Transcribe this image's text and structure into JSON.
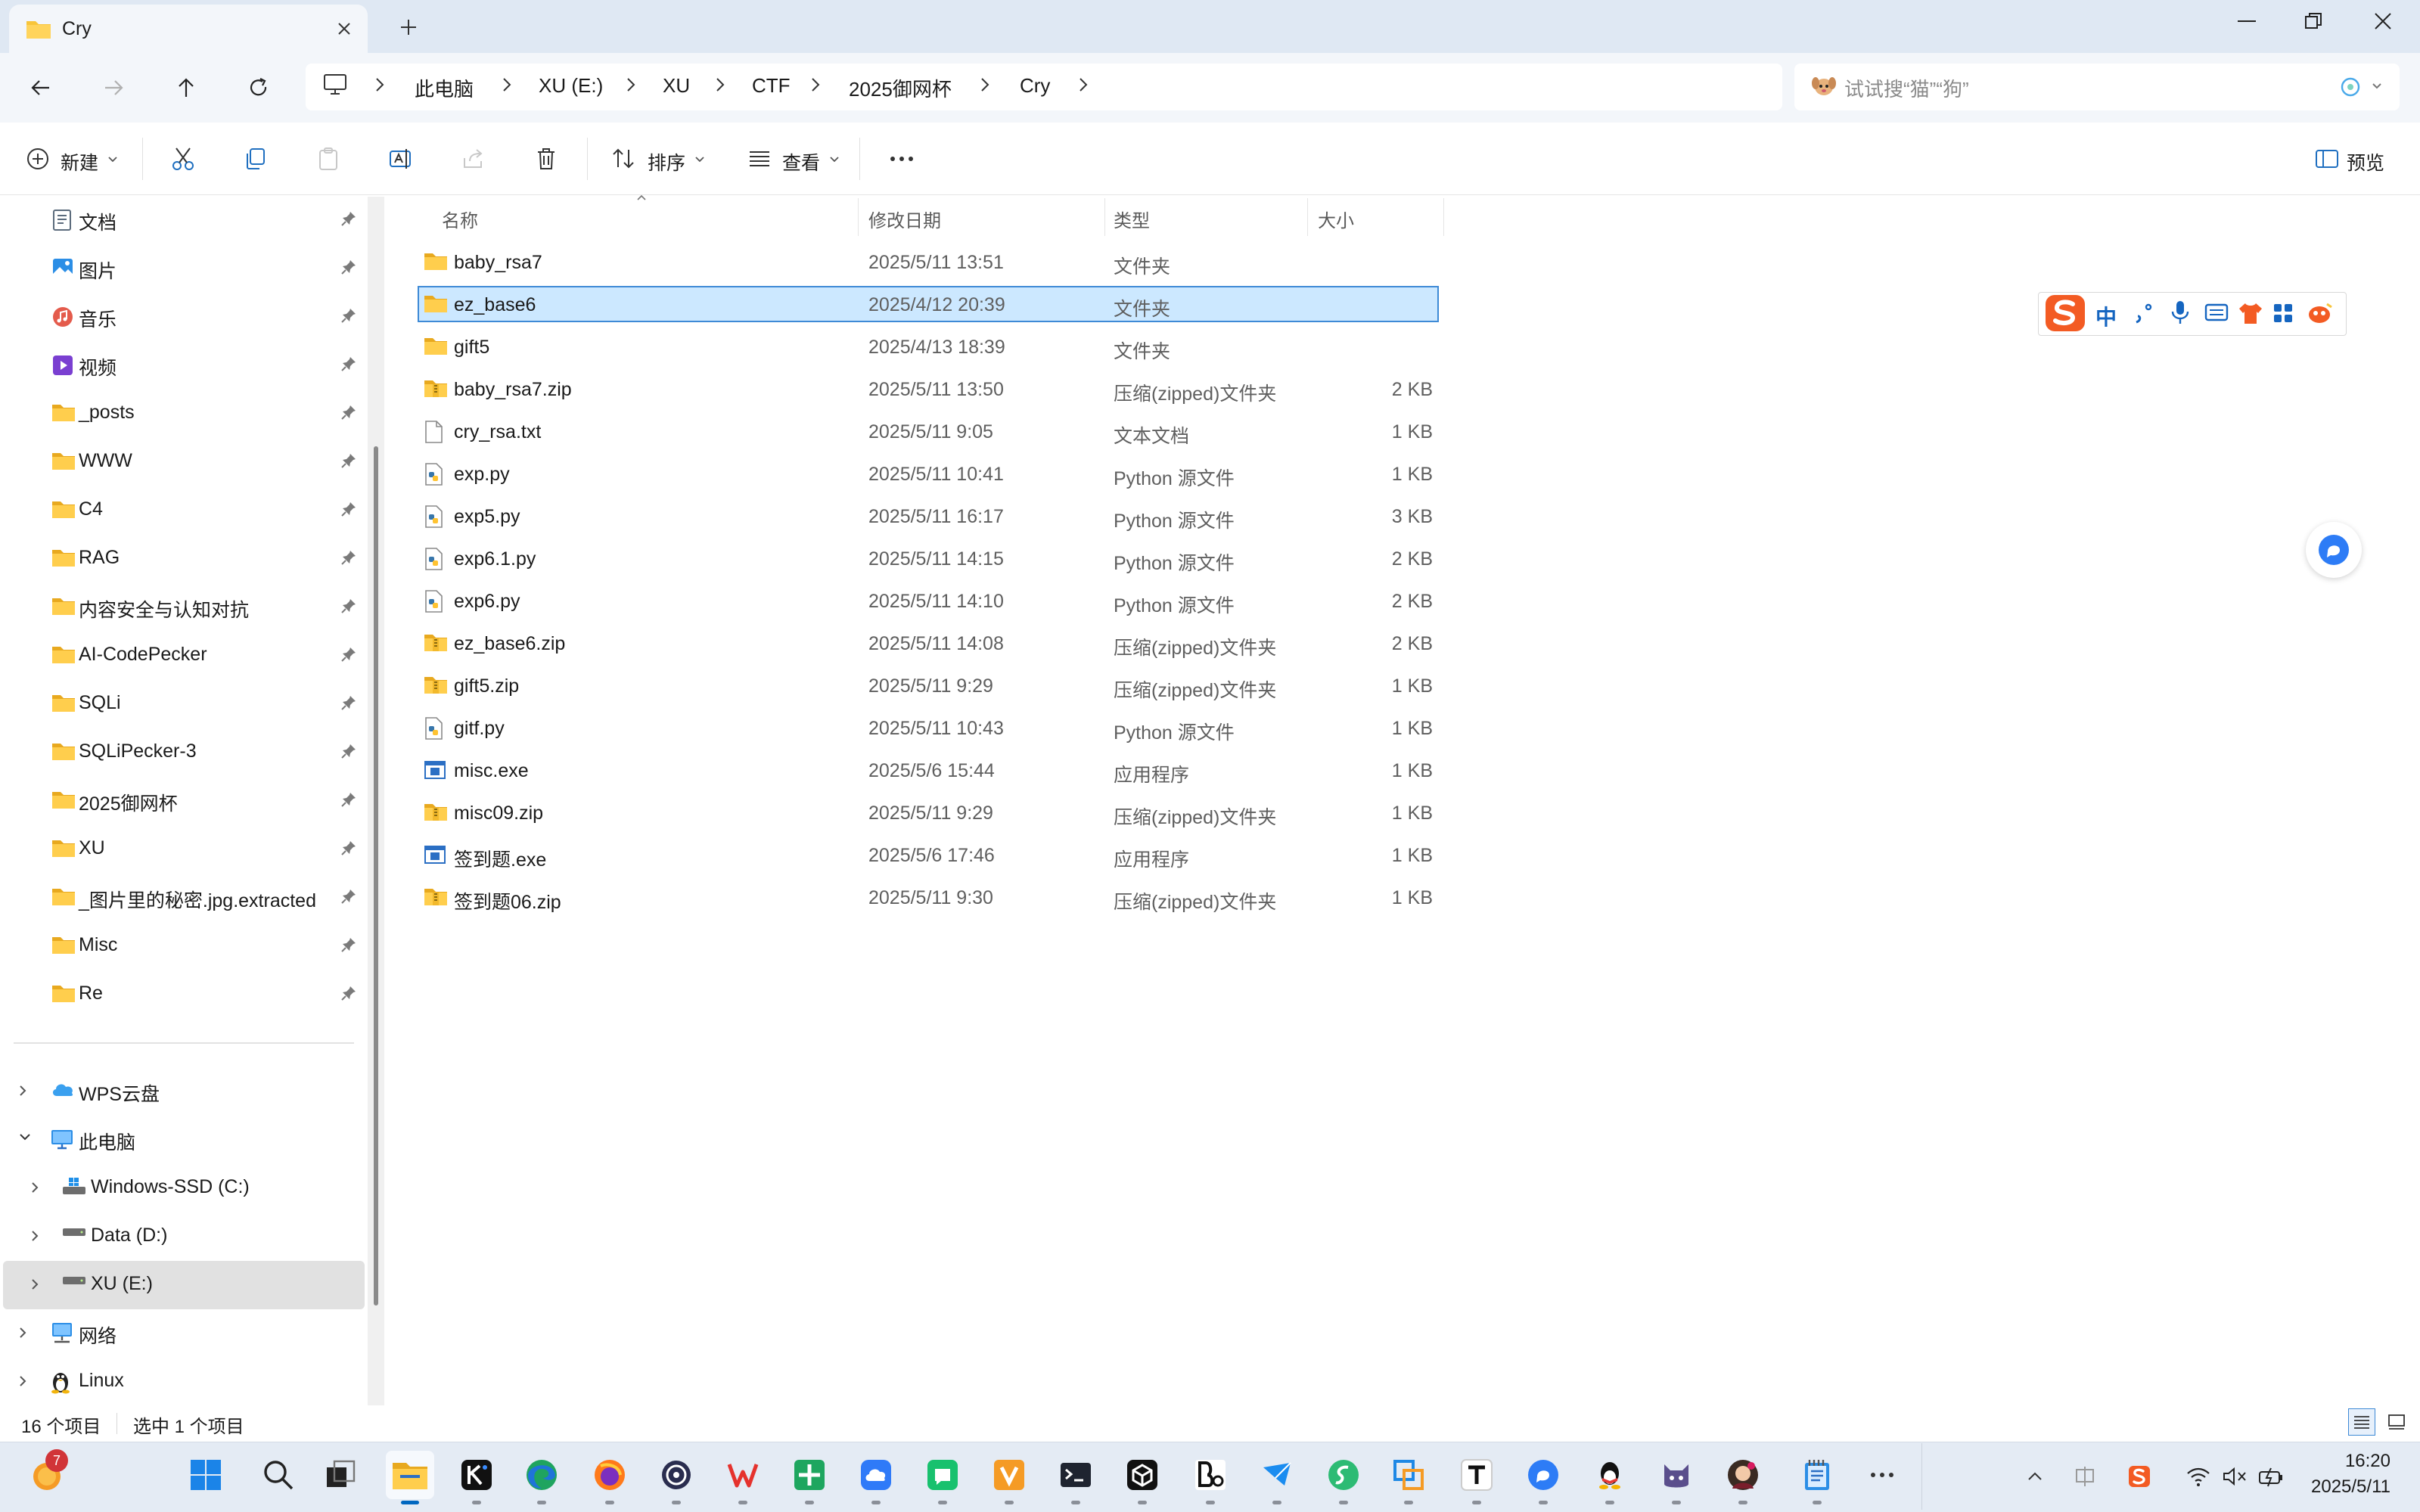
{
  "window": {
    "tab_title": "Cry"
  },
  "breadcrumb": [
    "此电脑",
    "XU (E:)",
    "XU",
    "CTF",
    "2025御网杯",
    "Cry"
  ],
  "search": {
    "placeholder": "试试搜“猫”“狗”"
  },
  "toolbar": {
    "new_label": "新建",
    "sort_label": "排序",
    "view_label": "查看",
    "preview_label": "预览"
  },
  "columns": {
    "name": "名称",
    "date": "修改日期",
    "type": "类型",
    "size": "大小"
  },
  "files": [
    {
      "name": "baby_rsa7",
      "date": "2025/5/11 13:51",
      "type": "文件夹",
      "size": "",
      "icon": "folder-icon"
    },
    {
      "name": "ez_base6",
      "date": "2025/4/12 20:39",
      "type": "文件夹",
      "size": "",
      "icon": "folder-icon"
    },
    {
      "name": "gift5",
      "date": "2025/4/13 18:39",
      "type": "文件夹",
      "size": "",
      "icon": "folder-icon"
    },
    {
      "name": "baby_rsa7.zip",
      "date": "2025/5/11 13:50",
      "type": "压缩(zipped)文件夹",
      "size": "2 KB",
      "icon": "zip-folder-icon"
    },
    {
      "name": "cry_rsa.txt",
      "date": "2025/5/11 9:05",
      "type": "文本文档",
      "size": "1 KB",
      "icon": "text-file-icon"
    },
    {
      "name": "exp.py",
      "date": "2025/5/11 10:41",
      "type": "Python 源文件",
      "size": "1 KB",
      "icon": "python-file-icon"
    },
    {
      "name": "exp5.py",
      "date": "2025/5/11 16:17",
      "type": "Python 源文件",
      "size": "3 KB",
      "icon": "python-file-icon"
    },
    {
      "name": "exp6.1.py",
      "date": "2025/5/11 14:15",
      "type": "Python 源文件",
      "size": "2 KB",
      "icon": "python-file-icon"
    },
    {
      "name": "exp6.py",
      "date": "2025/5/11 14:10",
      "type": "Python 源文件",
      "size": "2 KB",
      "icon": "python-file-icon"
    },
    {
      "name": "ez_base6.zip",
      "date": "2025/5/11 14:08",
      "type": "压缩(zipped)文件夹",
      "size": "2 KB",
      "icon": "zip-folder-icon"
    },
    {
      "name": "gift5.zip",
      "date": "2025/5/11 9:29",
      "type": "压缩(zipped)文件夹",
      "size": "1 KB",
      "icon": "zip-folder-icon"
    },
    {
      "name": "gitf.py",
      "date": "2025/5/11 10:43",
      "type": "Python 源文件",
      "size": "1 KB",
      "icon": "python-file-icon"
    },
    {
      "name": "misc.exe",
      "date": "2025/5/6 15:44",
      "type": "应用程序",
      "size": "1 KB",
      "icon": "exe-file-icon"
    },
    {
      "name": "misc09.zip",
      "date": "2025/5/11 9:29",
      "type": "压缩(zipped)文件夹",
      "size": "1 KB",
      "icon": "zip-folder-icon"
    },
    {
      "name": "签到题.exe",
      "date": "2025/5/6 17:46",
      "type": "应用程序",
      "size": "1 KB",
      "icon": "exe-file-icon"
    },
    {
      "name": "签到题06.zip",
      "date": "2025/5/11 9:30",
      "type": "压缩(zipped)文件夹",
      "size": "1 KB",
      "icon": "zip-folder-icon"
    }
  ],
  "sidebar": {
    "quick": [
      {
        "label": "文档",
        "icon": "documents-icon"
      },
      {
        "label": "图片",
        "icon": "pictures-icon"
      },
      {
        "label": "音乐",
        "icon": "music-icon"
      },
      {
        "label": "视频",
        "icon": "videos-icon"
      },
      {
        "label": "_posts",
        "icon": "folder-icon"
      },
      {
        "label": "WWW",
        "icon": "folder-icon"
      },
      {
        "label": "C4",
        "icon": "folder-icon"
      },
      {
        "label": "RAG",
        "icon": "folder-icon"
      },
      {
        "label": "内容安全与认知对抗",
        "icon": "folder-icon"
      },
      {
        "label": "AI-CodePecker",
        "icon": "folder-icon"
      },
      {
        "label": "SQLi",
        "icon": "folder-icon"
      },
      {
        "label": "SQLiPecker-3",
        "icon": "folder-icon"
      },
      {
        "label": "2025御网杯",
        "icon": "folder-icon"
      },
      {
        "label": "XU",
        "icon": "folder-icon"
      },
      {
        "label": "_图片里的秘密.jpg.extracted",
        "icon": "folder-icon"
      },
      {
        "label": "Misc",
        "icon": "folder-icon"
      },
      {
        "label": "Re",
        "icon": "folder-icon"
      }
    ],
    "tree": [
      {
        "label": "WPS云盘",
        "icon": "cloud-icon"
      },
      {
        "label": "此电脑",
        "icon": "computer-icon"
      },
      {
        "label": "Windows-SSD (C:)",
        "icon": "windows-drive-icon"
      },
      {
        "label": "Data (D:)",
        "icon": "drive-icon"
      },
      {
        "label": "XU (E:)",
        "icon": "drive-icon"
      },
      {
        "label": "网络",
        "icon": "network-icon"
      },
      {
        "label": "Linux",
        "icon": "linux-icon"
      }
    ]
  },
  "status": {
    "count": "16 个项目",
    "selected": "选中 1 个项目"
  },
  "taskbar": {
    "badge": "7",
    "time": "16:20",
    "date": "2025/5/11"
  },
  "ime": {
    "mode": "中"
  },
  "colors": {
    "accent": "#0067c0",
    "selection": "#cce8ff",
    "folder": "#f8c53a"
  }
}
